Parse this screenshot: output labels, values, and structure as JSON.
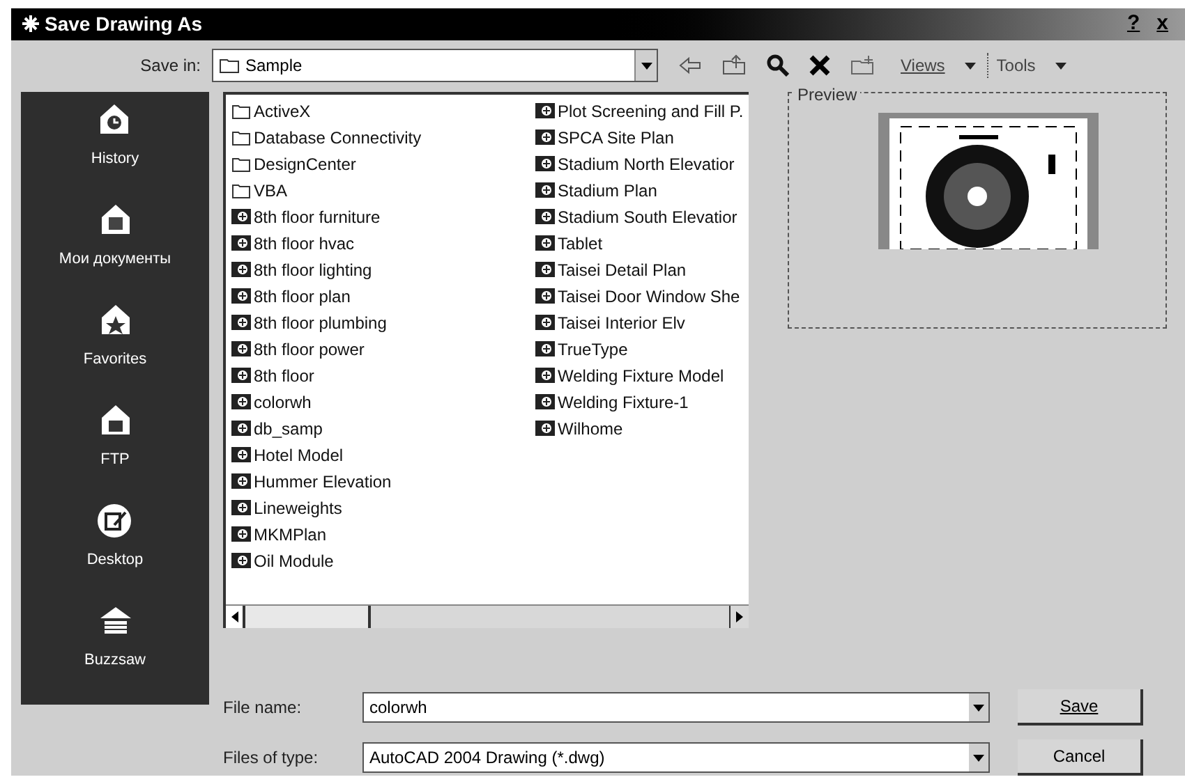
{
  "window": {
    "title": "Save Drawing As",
    "help": "?",
    "close": "x"
  },
  "save_in": {
    "label": "Save in:",
    "value": "Sample"
  },
  "toolbar": {
    "views": "Views",
    "tools": "Tools"
  },
  "places": [
    {
      "label": "History",
      "kind": "clock"
    },
    {
      "label": "Мои документы",
      "kind": "docs"
    },
    {
      "label": "Favorites",
      "kind": "star"
    },
    {
      "label": "FTP",
      "kind": "ftp"
    },
    {
      "label": "Desktop",
      "kind": "desktop"
    },
    {
      "label": "Buzzsaw",
      "kind": "saw"
    }
  ],
  "files": [
    {
      "name": "ActiveX",
      "kind": "folder"
    },
    {
      "name": "Database Connectivity",
      "kind": "folder"
    },
    {
      "name": "DesignCenter",
      "kind": "folder"
    },
    {
      "name": "VBA",
      "kind": "folder"
    },
    {
      "name": "8th floor furniture",
      "kind": "drawing"
    },
    {
      "name": "8th floor hvac",
      "kind": "drawing"
    },
    {
      "name": "8th floor lighting",
      "kind": "drawing"
    },
    {
      "name": "8th floor plan",
      "kind": "drawing"
    },
    {
      "name": "8th floor plumbing",
      "kind": "drawing"
    },
    {
      "name": "8th floor power",
      "kind": "drawing"
    },
    {
      "name": "8th floor",
      "kind": "drawing"
    },
    {
      "name": "colorwh",
      "kind": "drawing"
    },
    {
      "name": "db_samp",
      "kind": "drawing"
    },
    {
      "name": "Hotel Model",
      "kind": "drawing"
    },
    {
      "name": "Hummer Elevation",
      "kind": "drawing"
    },
    {
      "name": "Lineweights",
      "kind": "drawing"
    },
    {
      "name": "MKMPlan",
      "kind": "drawing"
    },
    {
      "name": "Oil Module",
      "kind": "drawing"
    },
    {
      "name": "Plot Screening and Fill P.",
      "kind": "drawing"
    },
    {
      "name": "SPCA Site Plan",
      "kind": "drawing"
    },
    {
      "name": "Stadium North Elevatior",
      "kind": "drawing"
    },
    {
      "name": "Stadium Plan",
      "kind": "drawing"
    },
    {
      "name": "Stadium South Elevatior",
      "kind": "drawing"
    },
    {
      "name": "Tablet",
      "kind": "drawing"
    },
    {
      "name": "Taisei Detail Plan",
      "kind": "drawing"
    },
    {
      "name": "Taisei Door Window She",
      "kind": "drawing"
    },
    {
      "name": "Taisei Interior Elv",
      "kind": "drawing"
    },
    {
      "name": "TrueType",
      "kind": "drawing"
    },
    {
      "name": "Welding Fixture Model",
      "kind": "drawing"
    },
    {
      "name": "Welding Fixture-1",
      "kind": "drawing"
    },
    {
      "name": "Wilhome",
      "kind": "drawing"
    }
  ],
  "preview": {
    "label": "Preview"
  },
  "file_name": {
    "label": "File name:",
    "value": "colorwh"
  },
  "file_type": {
    "label": "Files of type:",
    "value": "AutoCAD 2004 Drawing (*.dwg)"
  },
  "buttons": [
    "Save",
    "Cancel"
  ]
}
